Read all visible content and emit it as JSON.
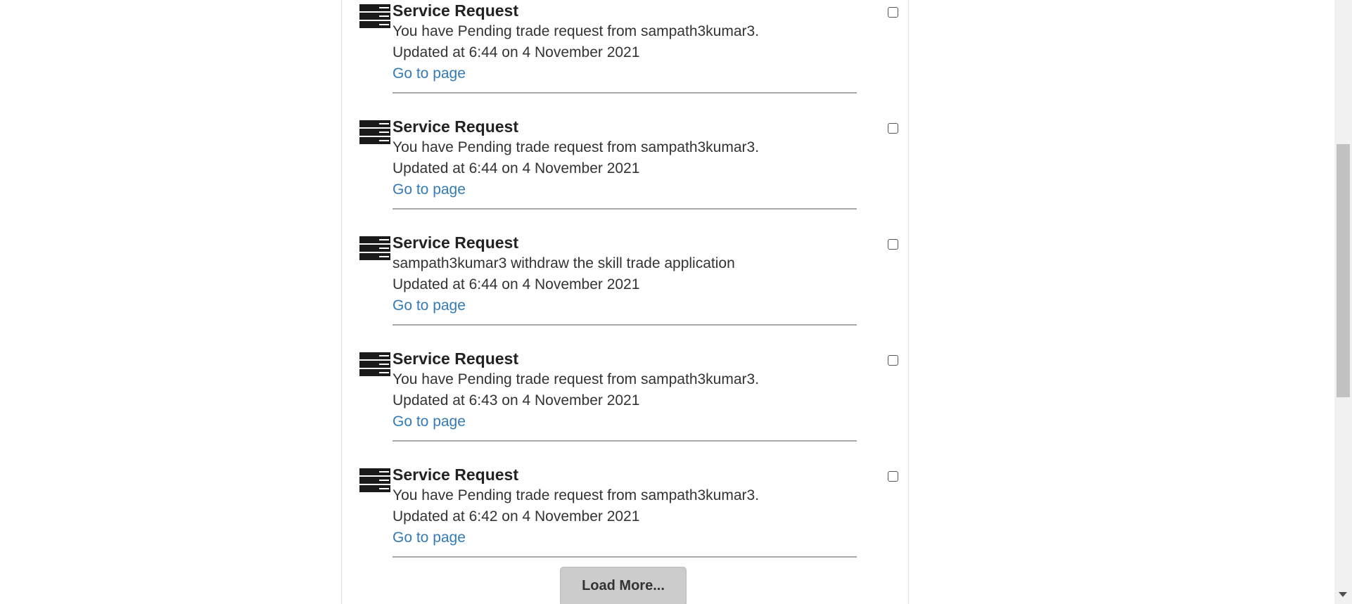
{
  "notifications": [
    {
      "title": "Service Request",
      "message": "You have Pending trade request from sampath3kumar3.",
      "updated": "Updated at 6:44 on 4 November 2021",
      "link": "Go to page",
      "icon": "server-icon"
    },
    {
      "title": "Service Request",
      "message": "You have Pending trade request from sampath3kumar3.",
      "updated": "Updated at 6:44 on 4 November 2021",
      "link": "Go to page",
      "icon": "server-icon"
    },
    {
      "title": "Service Request",
      "message": "sampath3kumar3 withdraw the skill trade application",
      "updated": "Updated at 6:44 on 4 November 2021",
      "link": "Go to page",
      "icon": "server-icon"
    },
    {
      "title": "Service Request",
      "message": "You have Pending trade request from sampath3kumar3.",
      "updated": "Updated at 6:43 on 4 November 2021",
      "link": "Go to page",
      "icon": "server-icon"
    },
    {
      "title": "Service Request",
      "message": "You have Pending trade request from sampath3kumar3.",
      "updated": "Updated at 6:42 on 4 November 2021",
      "link": "Go to page",
      "icon": "server-icon"
    }
  ],
  "load_more": {
    "label": "Load More..."
  },
  "colors": {
    "link": "#337ab7",
    "button_bg": "#cccccc",
    "divider": "#aaaaaa"
  }
}
